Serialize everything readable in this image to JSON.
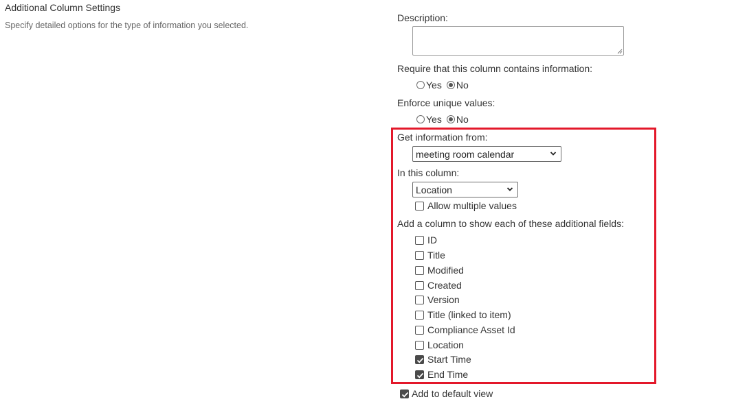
{
  "section": {
    "title": "Additional Column Settings",
    "description": "Specify detailed options for the type of information you selected."
  },
  "description_field": {
    "label": "Description:",
    "value": ""
  },
  "require": {
    "label": "Require that this column contains information:",
    "options": [
      "Yes",
      "No"
    ],
    "selected": "No"
  },
  "unique": {
    "label": "Enforce unique values:",
    "options": [
      "Yes",
      "No"
    ],
    "selected": "No"
  },
  "get_info": {
    "label": "Get information from:",
    "value": "meeting room calendar"
  },
  "in_column": {
    "label": "In this column:",
    "value": "Location"
  },
  "allow_multiple": {
    "label": "Allow multiple values",
    "checked": false
  },
  "additional_fields": {
    "label": "Add a column to show each of these additional fields:",
    "items": [
      {
        "label": "ID",
        "checked": false
      },
      {
        "label": "Title",
        "checked": false
      },
      {
        "label": "Modified",
        "checked": false
      },
      {
        "label": "Created",
        "checked": false
      },
      {
        "label": "Version",
        "checked": false
      },
      {
        "label": "Title (linked to item)",
        "checked": false
      },
      {
        "label": "Compliance Asset Id",
        "checked": false
      },
      {
        "label": "Location",
        "checked": false
      },
      {
        "label": "Start Time",
        "checked": true
      },
      {
        "label": "End Time",
        "checked": true
      }
    ]
  },
  "default_view": {
    "label": "Add to default view",
    "checked": true
  },
  "colors": {
    "highlight_border": "#e3182a",
    "checkbox_checked": "#4a4a4a"
  },
  "icons": {
    "dropdown": "chevron-down-icon",
    "checkmark": "checkmark-icon",
    "resize": "resize-grip-icon"
  }
}
